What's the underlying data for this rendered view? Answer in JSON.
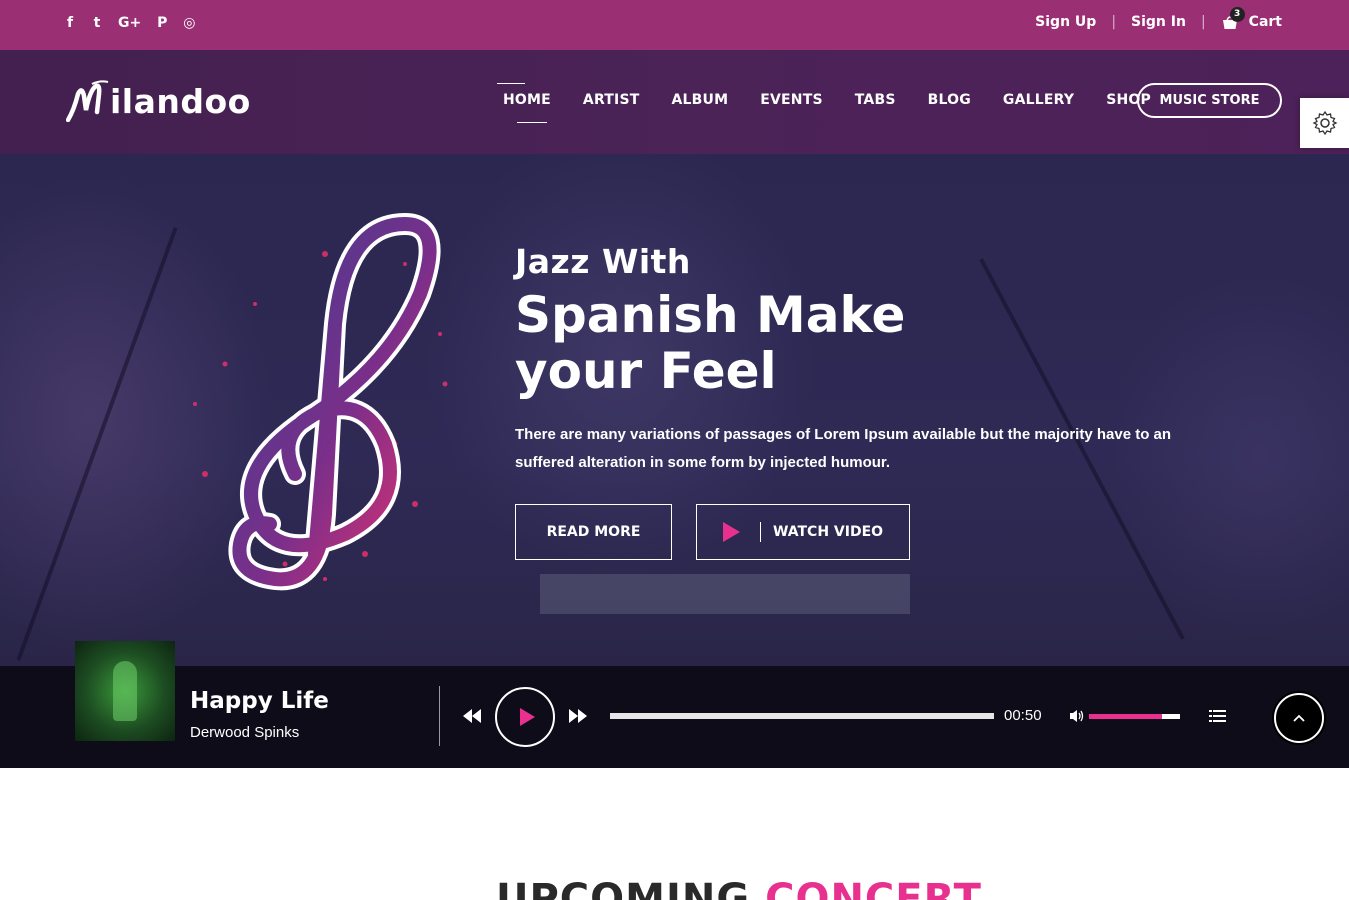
{
  "topbar": {
    "social": [
      {
        "name": "facebook",
        "glyph": "f"
      },
      {
        "name": "twitter",
        "glyph": "t"
      },
      {
        "name": "google-plus",
        "glyph": "G+"
      },
      {
        "name": "pinterest",
        "glyph": "P"
      },
      {
        "name": "instagram",
        "glyph": "◎"
      }
    ],
    "sign_up": "Sign Up",
    "sign_in": "Sign In",
    "cart_label": "Cart",
    "cart_count": "3"
  },
  "header": {
    "logo_text": "ilandoo",
    "nav": [
      "HOME",
      "ARTIST",
      "ALBUM",
      "EVENTS",
      "TABS",
      "BLOG",
      "GALLERY",
      "SHOP"
    ],
    "active_nav": "HOME",
    "store_button": "MUSIC STORE"
  },
  "hero": {
    "small_title": "Jazz With",
    "big_title": "Spanish Make your Feel",
    "description": "There are many variations of passages of Lorem Ipsum available but the majority have to an suffered alteration in some form by injected humour.",
    "read_more": "READ MORE",
    "watch_video": "WATCH VIDEO"
  },
  "player": {
    "track_title": "Happy Life",
    "track_artist": "Derwood Spinks",
    "time": "00:50",
    "progress_fraction": 0.0,
    "volume_fraction": 0.8
  },
  "section": {
    "title_dark": "UPCOMING",
    "title_accent": "CONCERT"
  },
  "colors": {
    "topbar": "#9a2f74",
    "header": "#4b2357",
    "accent": "#e8308f",
    "player_bg": "#0d0c18"
  }
}
